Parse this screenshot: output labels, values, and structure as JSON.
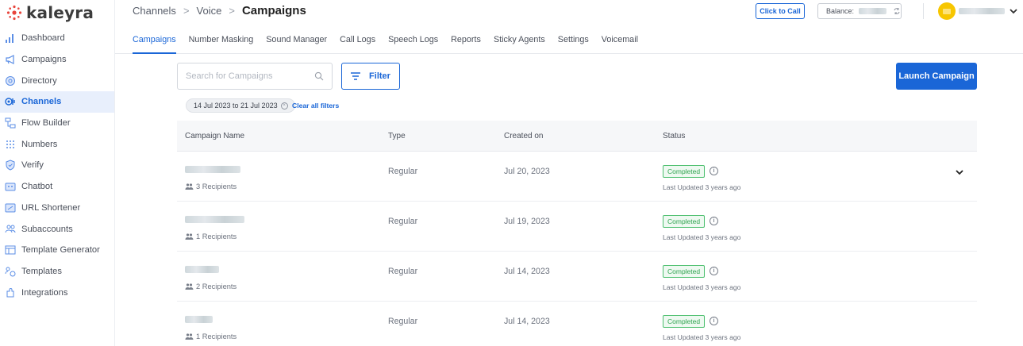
{
  "brand": {
    "logo_text": "kaleyra",
    "accent": "#1a66d7"
  },
  "sidebar": {
    "items": [
      {
        "label": "Dashboard",
        "icon": "bar-chart-icon"
      },
      {
        "label": "Campaigns",
        "icon": "megaphone-icon"
      },
      {
        "label": "Directory",
        "icon": "at-sign-icon"
      },
      {
        "label": "Channels",
        "icon": "channels-icon",
        "active": true
      },
      {
        "label": "Flow Builder",
        "icon": "flow-icon"
      },
      {
        "label": "Numbers",
        "icon": "dialpad-icon"
      },
      {
        "label": "Verify",
        "icon": "shield-check-icon"
      },
      {
        "label": "Chatbot",
        "icon": "chatbot-icon"
      },
      {
        "label": "URL Shortener",
        "icon": "link-icon"
      },
      {
        "label": "Subaccounts",
        "icon": "users-icon"
      },
      {
        "label": "Template Generator",
        "icon": "template-icon"
      },
      {
        "label": "Templates",
        "icon": "templates-icon"
      },
      {
        "label": "Integrations",
        "icon": "puzzle-icon"
      }
    ]
  },
  "header": {
    "breadcrumb": [
      "Channels",
      "Voice",
      "Campaigns"
    ],
    "separator": ">",
    "click_to_call": "Click to Call",
    "balance_label": "Balance:"
  },
  "tabs": [
    "Campaigns",
    "Number Masking",
    "Sound Manager",
    "Call Logs",
    "Speech Logs",
    "Reports",
    "Sticky Agents",
    "Settings",
    "Voicemail"
  ],
  "active_tab": "Campaigns",
  "toolbar": {
    "search_placeholder": "Search for Campaigns",
    "filter_label": "Filter",
    "launch_label": "Launch Campaign"
  },
  "filters": {
    "date_chip": "14 Jul 2023 to 21 Jul 2023",
    "chip_close": "×",
    "clear_label": "Clear all filters"
  },
  "table": {
    "columns": [
      "Campaign Name",
      "Type",
      "Created on",
      "Status"
    ],
    "rows": [
      {
        "recipients": "3 Recipients",
        "type": "Regular",
        "created": "Jul 20, 2023",
        "status": "Completed",
        "updated": "Last Updated 3 years ago",
        "expand": true
      },
      {
        "recipients": "1 Recipients",
        "type": "Regular",
        "created": "Jul 19, 2023",
        "status": "Completed",
        "updated": "Last Updated 3 years ago"
      },
      {
        "recipients": "2 Recipients",
        "type": "Regular",
        "created": "Jul 14, 2023",
        "status": "Completed",
        "updated": "Last Updated 3 years ago"
      },
      {
        "recipients": "1 Recipients",
        "type": "Regular",
        "created": "Jul 14, 2023",
        "status": "Completed",
        "updated": "Last Updated 3 years ago"
      }
    ],
    "info_glyph": "i"
  }
}
